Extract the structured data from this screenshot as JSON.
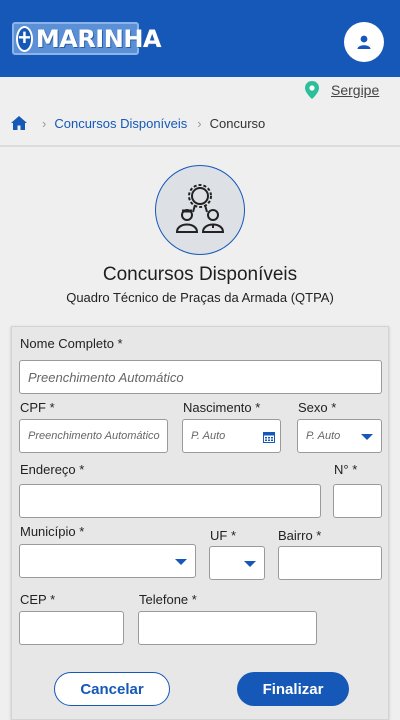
{
  "header": {
    "logo_text": "MARINHA",
    "logo_plus": "+"
  },
  "location": {
    "label": "Sergipe"
  },
  "breadcrumb": {
    "link": "Concursos Disponíveis",
    "current": "Concurso"
  },
  "page": {
    "title": "Concursos Disponíveis",
    "subtitle": "Quadro Técnico de Praças da Armada (QTPA)"
  },
  "form": {
    "nome": {
      "label": "Nome Completo *",
      "placeholder": "Preenchimento Automático"
    },
    "cpf": {
      "label": "CPF *",
      "placeholder": "Preenchimento Automático"
    },
    "nascimento": {
      "label": "Nascimento *",
      "placeholder": "P. Auto"
    },
    "sexo": {
      "label": "Sexo *",
      "placeholder": "P. Auto"
    },
    "endereco": {
      "label": "Endereço *",
      "value": ""
    },
    "numero": {
      "label": "N° *",
      "value": ""
    },
    "municipio": {
      "label": "Município *",
      "value": ""
    },
    "uf": {
      "label": "UF *",
      "value": ""
    },
    "bairro": {
      "label": "Bairro *",
      "value": ""
    },
    "cep": {
      "label": "CEP *",
      "value": ""
    },
    "telefone": {
      "label": "Telefone *",
      "value": ""
    }
  },
  "actions": {
    "cancel": "Cancelar",
    "finish": "Finalizar"
  },
  "colors": {
    "primary": "#1558b8",
    "location_pin": "#2bbf9a"
  },
  "icons": {
    "user": "user-icon",
    "pin": "map-pin-icon",
    "home": "home-icon",
    "calendar": "calendar-icon",
    "emblem": "people-award-icon"
  }
}
